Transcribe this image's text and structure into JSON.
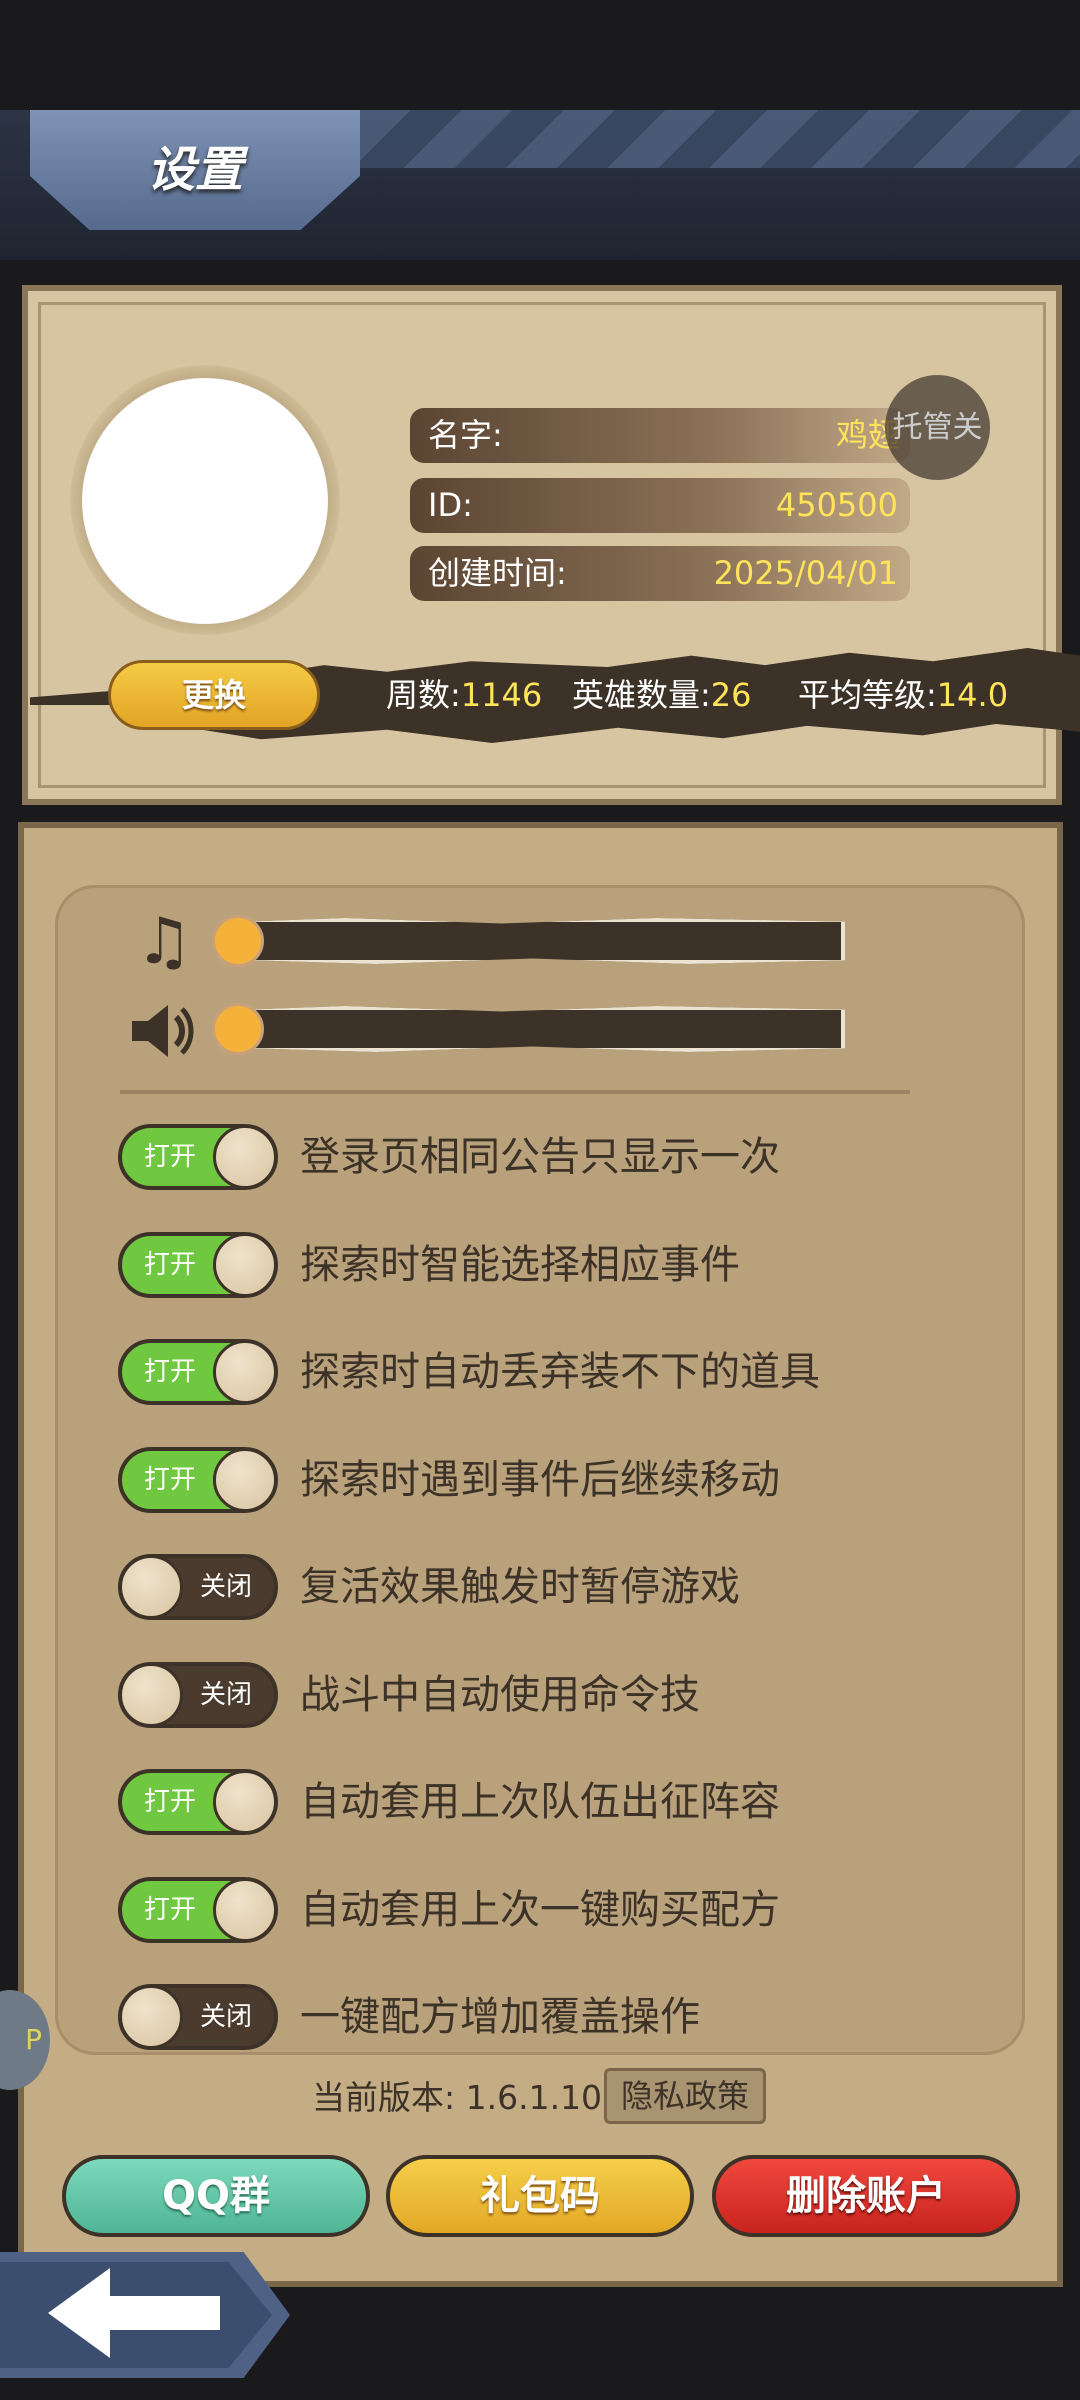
{
  "header": {
    "title": "设置"
  },
  "profile": {
    "name_label": "名字:",
    "name_value": "鸡翅",
    "id_label": "ID:",
    "id_value": "450500",
    "created_label": "创建时间:",
    "created_value": "2025/04/01",
    "trusteeship_label": "托管关",
    "change_label": "更换",
    "stats": {
      "weeks_label": "周数:",
      "weeks_value": "1146",
      "heroes_label": "英雄数量:",
      "heroes_value": "26",
      "avg_level_label": "平均等级:",
      "avg_level_value": "14.0"
    }
  },
  "audio": {
    "music_icon": "music-note-icon",
    "sound_icon": "speaker-icon",
    "music_volume_percent": 0,
    "sound_volume_percent": 0
  },
  "options": [
    {
      "on": true,
      "state_label": "打开",
      "label": "登录页相同公告只显示一次"
    },
    {
      "on": true,
      "state_label": "打开",
      "label": "探索时智能选择相应事件"
    },
    {
      "on": true,
      "state_label": "打开",
      "label": "探索时自动丢弃装不下的道具"
    },
    {
      "on": true,
      "state_label": "打开",
      "label": "探索时遇到事件后继续移动"
    },
    {
      "on": false,
      "state_label": "关闭",
      "label": "复活效果触发时暂停游戏"
    },
    {
      "on": false,
      "state_label": "关闭",
      "label": "战斗中自动使用命令技"
    },
    {
      "on": true,
      "state_label": "打开",
      "label": "自动套用上次队伍出征阵容"
    },
    {
      "on": true,
      "state_label": "打开",
      "label": "自动套用上次一键购买配方"
    },
    {
      "on": false,
      "state_label": "关闭",
      "label": "一键配方增加覆盖操作"
    }
  ],
  "footer": {
    "version_text": "当前版本: 1.6.1.10",
    "privacy_label": "隐私政策",
    "qq_label": "QQ群",
    "gift_label": "礼包码",
    "delete_label": "删除账户"
  },
  "side_bubble_text": "P",
  "colors": {
    "toggle_on": "#6fc83f",
    "toggle_off": "#4a3b2e",
    "value_yellow": "#ffe35a",
    "delete_red": "#d9322b"
  }
}
